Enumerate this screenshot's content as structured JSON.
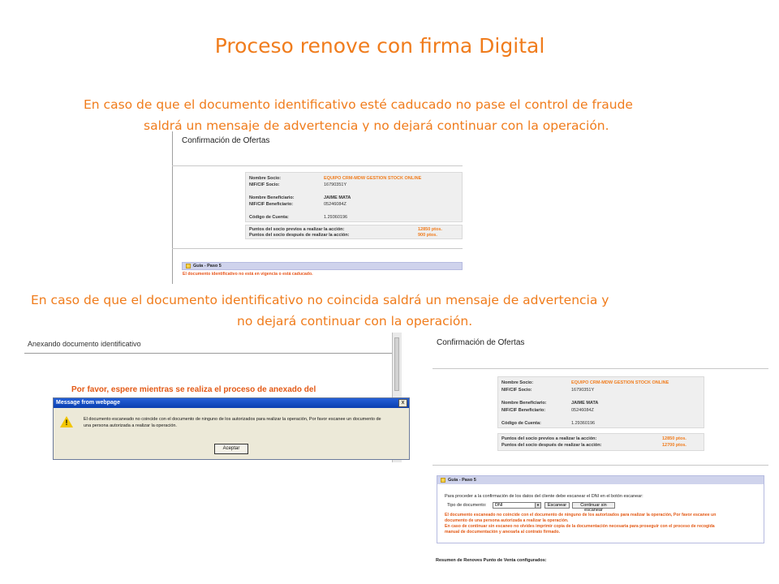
{
  "slide": {
    "title": "Proceso renove con firma Digital",
    "para1_line1": "En caso de que el documento identificativo esté caducado no pase el control de fraude",
    "para1_line2": "saldrá un mensaje  de advertencia y no dejará continuar con la operación.",
    "para2_line1": "En caso de que el documento identificativo  no coincida saldrá un mensaje  de advertencia y",
    "para2_line2": "no dejará continuar con la operación."
  },
  "screenshot1": {
    "header": "Confirmación de Ofertas",
    "fields": [
      {
        "label": "Nombre Socio:",
        "value": "EQUIPO CRM-MDW GESTION STOCK ONLINE"
      },
      {
        "label": "NIF/CIF Socio:",
        "value": "16790351Y"
      },
      {
        "label": "Nombre Beneficiario:",
        "value": "JAIME MATA"
      },
      {
        "label": "NIF/CIF Beneficiario:",
        "value": "05246084Z"
      },
      {
        "label": "Código de Cuenta:",
        "value": "1.29360196"
      }
    ],
    "points": [
      {
        "label": "Puntos del socio previos a realizar la acción:",
        "value": "12850 ptos."
      },
      {
        "label": "Puntos del socio después de realizar la acción:",
        "value": "900 ptos."
      }
    ],
    "guia_label": "Guia - Paso 5",
    "error_text": "El documento identificativo no está en vigencia o está caducado."
  },
  "screenshot2": {
    "page_title": "Anexando documento identificativo",
    "wait_text": "Por favor, espere mientras se realiza el proceso de anexado del",
    "dialog_title": "Message from webpage",
    "close_label": "x",
    "dialog_line1": "El documento escaneado no coincide con el documento de ninguno de los autorizados para realizar la operación, Por favor escanee un documento de",
    "dialog_line2": "una persona autorizada a realizar la operación.",
    "ok_label": "Aceptar"
  },
  "screenshot3": {
    "header": "Confirmación de Ofertas",
    "fields": [
      {
        "label": "Nombre Socio:",
        "value": "EQUIPO CRM-MDW GESTION STOCK ONLINE"
      },
      {
        "label": "NIF/CIF Socio:",
        "value": "16790351Y"
      },
      {
        "label": "Nombre Beneficiario:",
        "value": "JAIME MATA"
      },
      {
        "label": "NIF/CIF Beneficiario:",
        "value": "05246084Z"
      },
      {
        "label": "Código de Cuenta:",
        "value": "1.29360196"
      }
    ],
    "points": [
      {
        "label": "Puntos del socio previos a realizar la acción:",
        "value": "12850 ptos."
      },
      {
        "label": "Puntos del socio después de realizar la acción:",
        "value": "12700 ptos."
      }
    ],
    "guia_label": "Guia - Paso 5",
    "instruction": "Para proceder a la confirmación de los datos del cliente debe escanear el DNI en el botón escanear:",
    "doc_type_label": "Tipo de documento:",
    "doc_type_value": "DNI",
    "scan_button": "Escanear",
    "continue_button": "Continuar sin escanear",
    "warn_line1": "El documento escaneado no coincide con el documento de ninguno de los autorizados para realizar la operación, Por favor escanee un",
    "warn_line2": "documento de una persona autorizada a realizar la operación.",
    "warn_line3": "En caso de continuar sin escaneo no olvides imprimir copia de la documentación necesaria para proseguir con el proceso de recogida",
    "warn_line4": "manual de documentación y anexarla al contrato firmado.",
    "resumen": "Resumen de Renoves Punto de Venta configurados:"
  }
}
